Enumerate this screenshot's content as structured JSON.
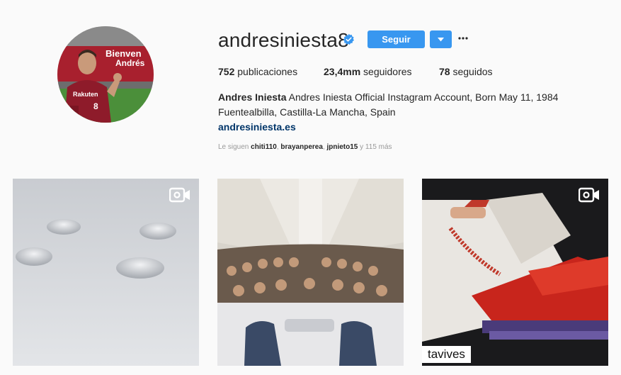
{
  "profile": {
    "username": "andresiniesta8",
    "verified": true,
    "follow_label": "Seguir",
    "more_icon": "ellipsis-icon",
    "dropdown_icon": "caret-down-icon"
  },
  "stats": {
    "posts_count": "752",
    "posts_label": "publicaciones",
    "followers_count": "23,4mm",
    "followers_label": "seguidores",
    "following_count": "78",
    "following_label": "seguidos"
  },
  "bio": {
    "full_name": "Andres Iniesta",
    "line1": "Andres Iniesta Official Instagram Account, Born May 11, 1984",
    "line2": "Fuentealbilla, Castilla-La Mancha, Spain",
    "website": "andresiniesta.es"
  },
  "followed_by": {
    "prefix": "Le siguen",
    "users": [
      "chiti110",
      "brayanperea",
      "jpnieto15"
    ],
    "suffix": "y 115 más"
  },
  "avatar": {
    "banner_line1": "Bienven",
    "banner_line2": "Andrés",
    "jersey_text": "Rakuten",
    "jersey_number": "8"
  },
  "posts": [
    {
      "type": "video",
      "icon": "video-camera-icon"
    },
    {
      "type": "image"
    },
    {
      "type": "video",
      "icon": "video-camera-icon",
      "caption": "tavives"
    }
  ],
  "colors": {
    "accent": "#3897f0",
    "link": "#003569",
    "muted": "#999999",
    "text": "#262626"
  }
}
